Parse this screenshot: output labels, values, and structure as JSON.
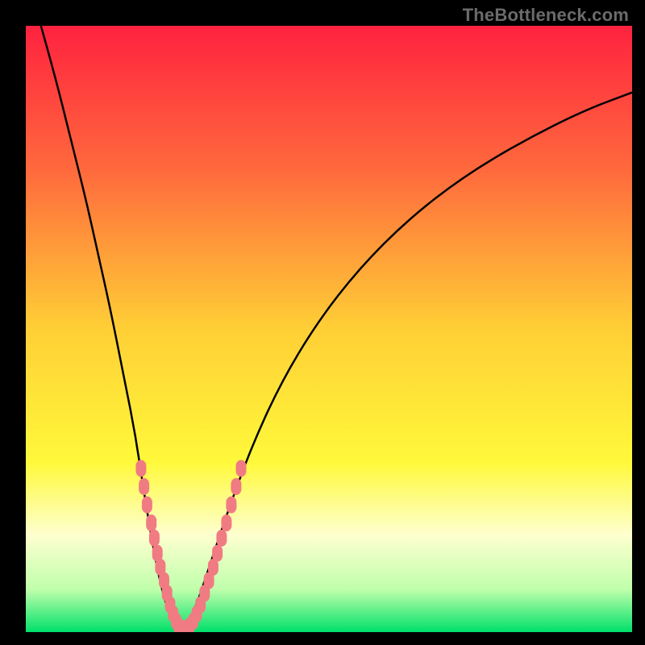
{
  "watermark": "TheBottleneck.com",
  "colors": {
    "bg_top": "#ff223f",
    "bg_mid_upper": "#ff7641",
    "bg_mid": "#ffd33a",
    "bg_mid_lower": "#fff83a",
    "bg_pale": "#fdffb0",
    "bg_green_light": "#97f884",
    "bg_green": "#00e06a",
    "curve_stroke": "#000000",
    "bead_fill": "#f17b82",
    "frame": "#000000"
  },
  "chart_data": {
    "type": "line",
    "title": "",
    "xlabel": "",
    "ylabel": "",
    "x_range_pct": [
      0,
      100
    ],
    "y_range_pct": [
      0,
      100
    ],
    "series": [
      {
        "name": "left-curve",
        "x_pct": [
          2.5,
          5,
          7.5,
          10,
          12,
          14,
          16,
          18,
          19.5,
          21,
          22,
          23,
          24,
          25
        ],
        "y_pct": [
          100,
          91,
          81,
          71,
          62,
          53,
          43,
          33,
          23,
          14,
          9,
          5,
          2,
          0
        ]
      },
      {
        "name": "right-curve",
        "x_pct": [
          26,
          28,
          30,
          33,
          37,
          42,
          48,
          55,
          63,
          72,
          82,
          92,
          100
        ],
        "y_pct": [
          0,
          4,
          10,
          19,
          30,
          41,
          51,
          60,
          68,
          75,
          81,
          86,
          89
        ]
      }
    ],
    "bead_clusters_pct": [
      {
        "name": "left-arm",
        "points": [
          [
            19.0,
            27
          ],
          [
            19.5,
            24
          ],
          [
            20.0,
            21
          ],
          [
            20.7,
            18
          ],
          [
            21.2,
            15.5
          ],
          [
            21.7,
            13
          ],
          [
            22.2,
            10.7
          ],
          [
            22.8,
            8.5
          ],
          [
            23.3,
            6.4
          ],
          [
            23.8,
            4.5
          ],
          [
            24.3,
            3.0
          ],
          [
            24.8,
            1.8
          ]
        ]
      },
      {
        "name": "valley",
        "points": [
          [
            25.2,
            1.0
          ],
          [
            25.8,
            0.6
          ],
          [
            26.4,
            0.6
          ],
          [
            27.0,
            1.0
          ],
          [
            27.6,
            1.8
          ]
        ]
      },
      {
        "name": "right-arm",
        "points": [
          [
            28.2,
            3.0
          ],
          [
            28.8,
            4.5
          ],
          [
            29.5,
            6.4
          ],
          [
            30.2,
            8.5
          ],
          [
            30.9,
            10.7
          ],
          [
            31.6,
            13.0
          ],
          [
            32.3,
            15.5
          ],
          [
            33.1,
            18.0
          ],
          [
            33.9,
            21.0
          ],
          [
            34.7,
            24.0
          ],
          [
            35.5,
            27.0
          ]
        ]
      }
    ],
    "gradient_stops": [
      {
        "offset": 0.0,
        "color": "#ff223f"
      },
      {
        "offset": 0.24,
        "color": "#ff6a3d"
      },
      {
        "offset": 0.5,
        "color": "#ffcf36"
      },
      {
        "offset": 0.72,
        "color": "#fff93a"
      },
      {
        "offset": 0.84,
        "color": "#feffcf"
      },
      {
        "offset": 0.93,
        "color": "#bfffab"
      },
      {
        "offset": 1.0,
        "color": "#00e06a"
      }
    ]
  }
}
